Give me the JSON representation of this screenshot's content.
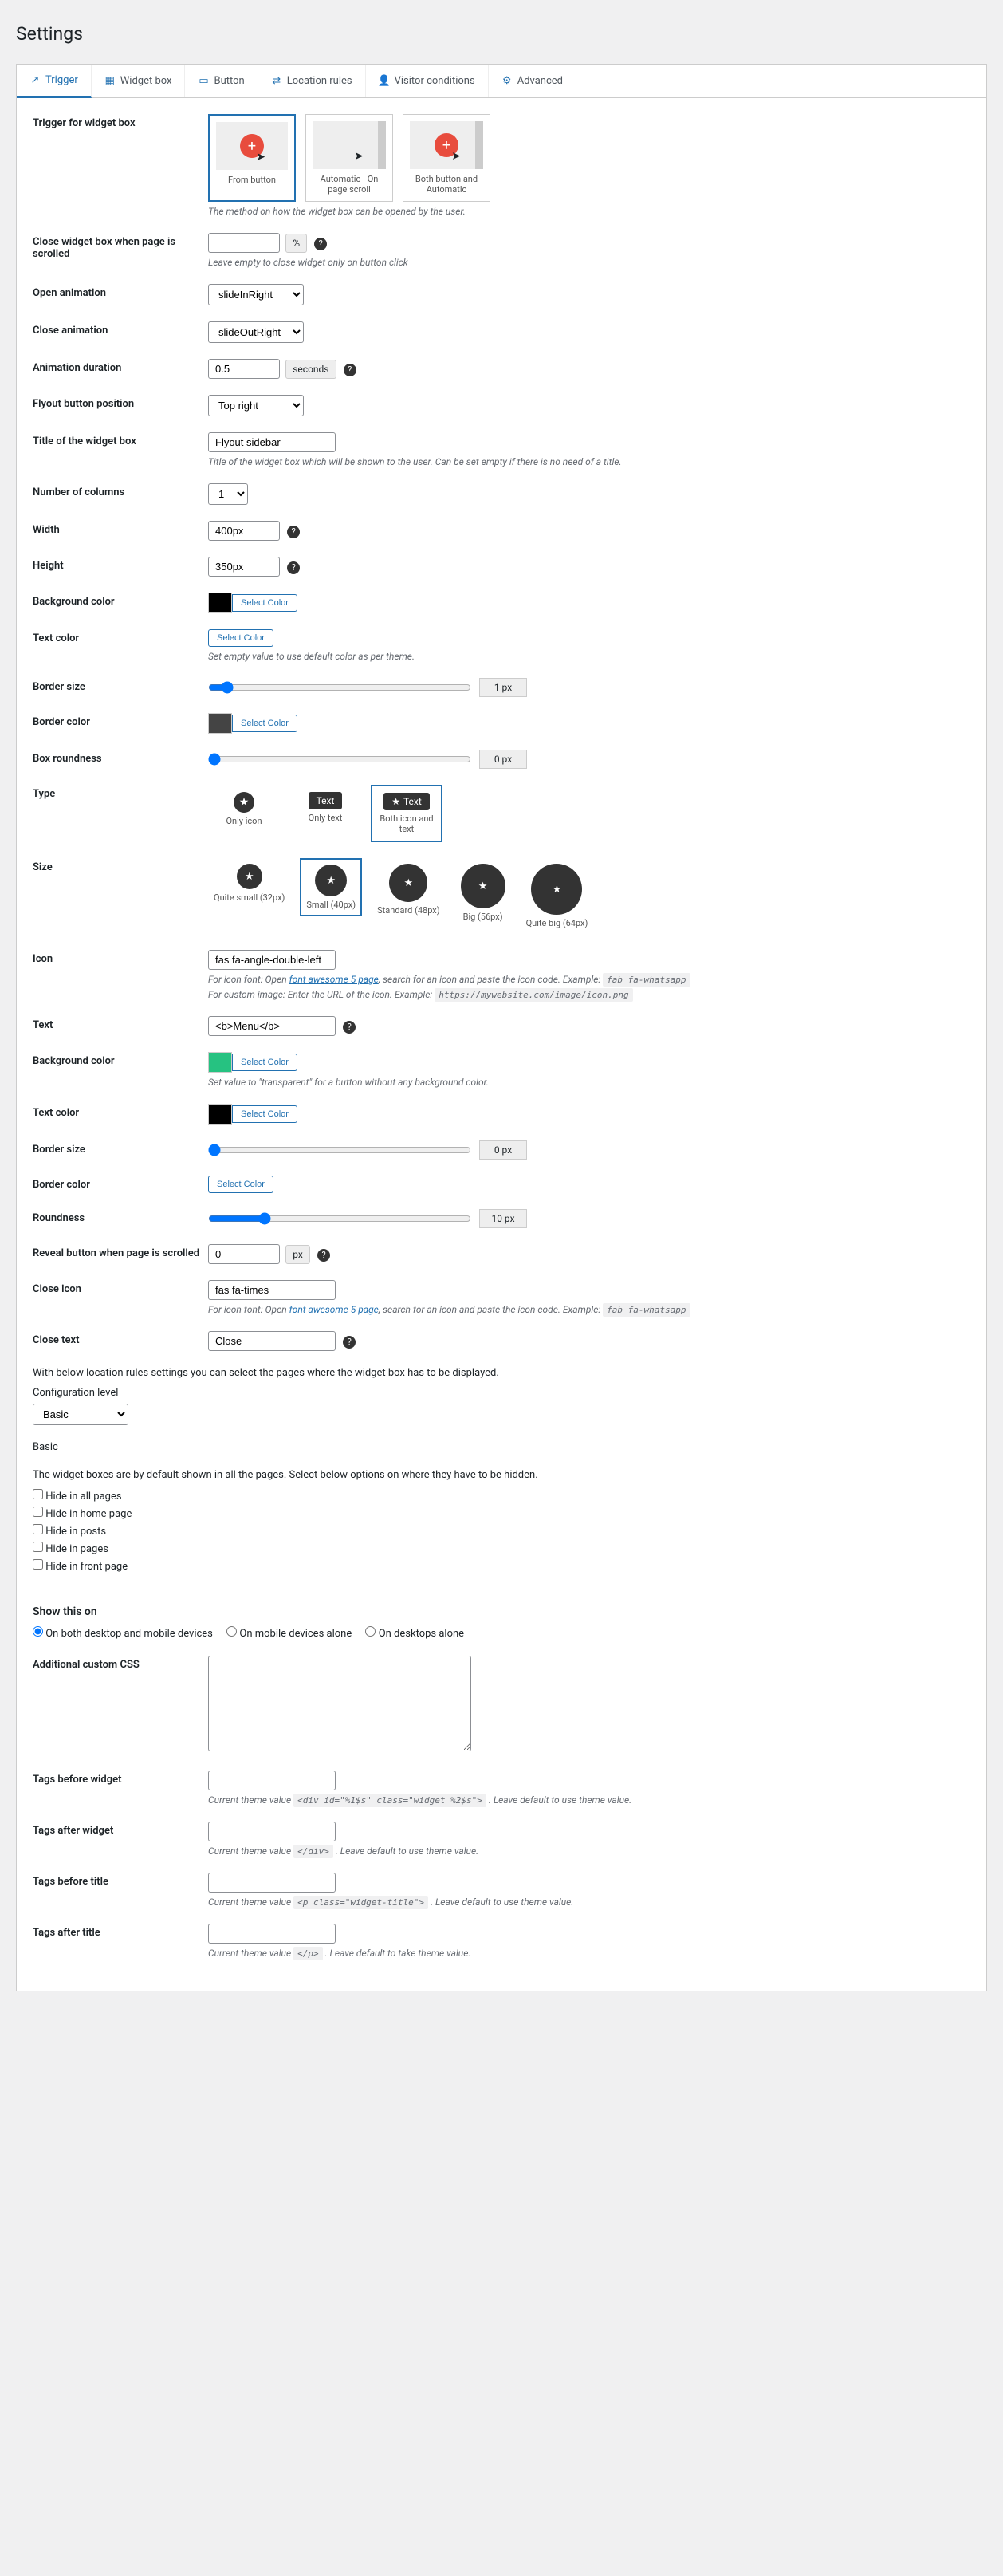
{
  "page_title": "Settings",
  "tabs": [
    {
      "label": "Trigger",
      "icon": "external"
    },
    {
      "label": "Widget box",
      "icon": "layout"
    },
    {
      "label": "Button",
      "icon": "button"
    },
    {
      "label": "Location rules",
      "icon": "location"
    },
    {
      "label": "Visitor conditions",
      "icon": "user"
    },
    {
      "label": "Advanced",
      "icon": "gear"
    }
  ],
  "trigger": {
    "label": "Trigger for widget box",
    "options": [
      {
        "label": "From button"
      },
      {
        "label": "Automatic - On page scroll"
      },
      {
        "label": "Both button and Automatic"
      }
    ],
    "desc": "The method on how the widget box can be opened by the user."
  },
  "close_scroll": {
    "label": "Close widget box when page is scrolled",
    "value": "",
    "suffix": "%",
    "desc": "Leave empty to close widget only on button click"
  },
  "open_anim": {
    "label": "Open animation",
    "value": "slideInRight"
  },
  "close_anim": {
    "label": "Close animation",
    "value": "slideOutRight"
  },
  "anim_duration": {
    "label": "Animation duration",
    "value": "0.5",
    "suffix": "seconds"
  },
  "flyout_pos": {
    "label": "Flyout button position",
    "value": "Top right"
  },
  "box_title": {
    "label": "Title of the widget box",
    "value": "Flyout sidebar",
    "desc": "Title of the widget box which will be shown to the user. Can be set empty if there is no need of a title."
  },
  "columns": {
    "label": "Number of columns",
    "value": "1"
  },
  "width": {
    "label": "Width",
    "value": "400px"
  },
  "height": {
    "label": "Height",
    "value": "350px"
  },
  "bg_color": {
    "label": "Background color",
    "swatch": "#000000",
    "btn": "Select Color"
  },
  "text_color": {
    "label": "Text color",
    "btn": "Select Color",
    "desc": "Set empty value to use default color as per theme."
  },
  "border_size": {
    "label": "Border size",
    "value": 1,
    "display": "1 px"
  },
  "border_color": {
    "label": "Border color",
    "swatch": "#444444",
    "btn": "Select Color"
  },
  "roundness": {
    "label": "Box roundness",
    "value": 0,
    "display": "0 px"
  },
  "type": {
    "label": "Type",
    "options": [
      {
        "label": "Only icon"
      },
      {
        "label": "Only text",
        "text": "Text"
      },
      {
        "label": "Both icon and text",
        "text": "Text"
      }
    ]
  },
  "size": {
    "label": "Size",
    "options": [
      {
        "label": "Quite small (32px)",
        "px": 32
      },
      {
        "label": "Small (40px)",
        "px": 40
      },
      {
        "label": "Standard (48px)",
        "px": 48
      },
      {
        "label": "Big (56px)",
        "px": 56
      },
      {
        "label": "Quite big (64px)",
        "px": 64
      }
    ]
  },
  "icon": {
    "label": "Icon",
    "value": "fas fa-angle-double-left",
    "desc1_a": "For icon font: Open ",
    "desc1_link": "font awesome 5 page",
    "desc1_b": ", search for an icon and paste the icon code. Example: ",
    "desc1_code": "fab fa-whatsapp",
    "desc2_a": "For custom image: Enter the URL of the icon. Example: ",
    "desc2_code": "https://mywebsite.com/image/icon.png"
  },
  "btn_text": {
    "label": "Text",
    "value": "<b>Menu</b>"
  },
  "btn_bg": {
    "label": "Background color",
    "swatch": "#26c281",
    "btn": "Select Color",
    "desc": "Set value to \"transparent\" for a button without any background color."
  },
  "btn_text_color": {
    "label": "Text color",
    "swatch": "#000000",
    "btn": "Select Color"
  },
  "btn_border_size": {
    "label": "Border size",
    "value": 0,
    "display": "0 px"
  },
  "btn_border_color": {
    "label": "Border color",
    "btn": "Select Color"
  },
  "btn_roundness": {
    "label": "Roundness",
    "value": 10,
    "display": "10 px"
  },
  "reveal": {
    "label": "Reveal button when page is scrolled",
    "value": "0",
    "suffix": "px"
  },
  "close_icon": {
    "label": "Close icon",
    "value": "fas fa-times",
    "desc_a": "For icon font: Open ",
    "desc_link": "font awesome 5 page",
    "desc_b": ", search for an icon and paste the icon code. Example: ",
    "desc_code": "fab fa-whatsapp"
  },
  "close_text": {
    "label": "Close text",
    "value": "Close"
  },
  "location_intro": "With below location rules settings you can select the pages where the widget box has to be displayed.",
  "config_level": {
    "label": "Configuration level",
    "value": "Basic"
  },
  "basic_heading": "Basic",
  "basic_desc": "The widget boxes are by default shown in all the pages. Select below options on where they have to be hidden.",
  "hide_opts": [
    "Hide in all pages",
    "Hide in home page",
    "Hide in posts",
    "Hide in pages",
    "Hide in front page"
  ],
  "show_on": {
    "label": "Show this on",
    "options": [
      "On both desktop and mobile devices",
      "On mobile devices alone",
      "On desktops alone"
    ]
  },
  "custom_css": {
    "label": "Additional custom CSS",
    "value": ""
  },
  "tags_before_widget": {
    "label": "Tags before widget",
    "value": "",
    "desc_a": "Current theme value ",
    "desc_code": "<div id=\"%1$s\" class=\"widget %2$s\">",
    "desc_b": " . Leave default to use theme value."
  },
  "tags_after_widget": {
    "label": "Tags after widget",
    "value": "",
    "desc_a": "Current theme value ",
    "desc_code": "</div>",
    "desc_b": " . Leave default to use theme value."
  },
  "tags_before_title": {
    "label": "Tags before title",
    "value": "",
    "desc_a": "Current theme value ",
    "desc_code": "<p class=\"widget-title\">",
    "desc_b": " . Leave default to use theme value."
  },
  "tags_after_title": {
    "label": "Tags after title",
    "value": "",
    "desc_a": "Current theme value ",
    "desc_code": "</p>",
    "desc_b": " . Leave default to take theme value."
  }
}
